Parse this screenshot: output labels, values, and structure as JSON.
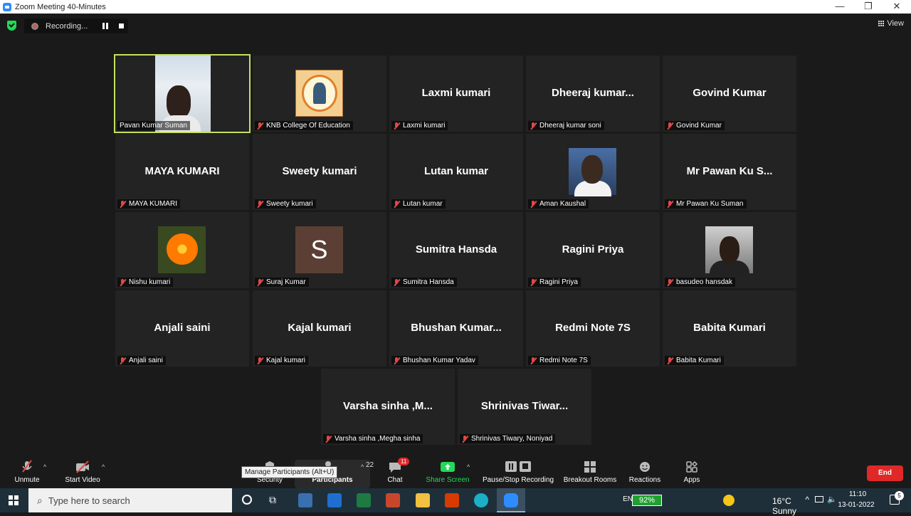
{
  "window": {
    "title": "Zoom Meeting 40-Minutes",
    "minimize": "—",
    "maximize": "❐",
    "close": "✕"
  },
  "recording": {
    "label": "Recording..."
  },
  "view": {
    "label": "View"
  },
  "participants": [
    {
      "display": "",
      "label": "Pavan Kumar Suman",
      "type": "video",
      "active": true
    },
    {
      "display": "",
      "label": "KNB College Of Education",
      "type": "college"
    },
    {
      "display": "Laxmi kumari",
      "label": "Laxmi kumari",
      "type": "name"
    },
    {
      "display": "Dheeraj  kumar...",
      "label": "Dheeraj kumar soni",
      "type": "name"
    },
    {
      "display": "Govind Kumar",
      "label": "Govind Kumar",
      "type": "name"
    },
    {
      "display": "MAYA KUMARI",
      "label": "MAYA KUMARI",
      "type": "name"
    },
    {
      "display": "Sweety kumari",
      "label": "Sweety kumari",
      "type": "name"
    },
    {
      "display": "Lutan kumar",
      "label": "Lutan kumar",
      "type": "name"
    },
    {
      "display": "",
      "label": "Aman Kaushal",
      "type": "aman"
    },
    {
      "display": "Mr  Pawan Ku S...",
      "label": "Mr  Pawan Ku Suman",
      "type": "name"
    },
    {
      "display": "",
      "label": "Nishu kumari",
      "type": "flower"
    },
    {
      "display": "S",
      "label": "Suraj Kumar",
      "type": "initial"
    },
    {
      "display": "Sumitra Hansda",
      "label": "Sumitra Hansda",
      "type": "name"
    },
    {
      "display": "Ragini  Priya",
      "label": "Ragini  Priya",
      "type": "name"
    },
    {
      "display": "",
      "label": "basudeo hansdak",
      "type": "basu"
    },
    {
      "display": "Anjali saini",
      "label": "Anjali saini",
      "type": "name"
    },
    {
      "display": "Kajal kumari",
      "label": "Kajal kumari",
      "type": "name"
    },
    {
      "display": "Bhushan  Kumar...",
      "label": "Bhushan Kumar Yadav",
      "type": "name"
    },
    {
      "display": "Redmi Note 7S",
      "label": "Redmi Note 7S",
      "type": "name"
    },
    {
      "display": "Babita Kumari",
      "label": "Babita Kumari",
      "type": "name"
    },
    {
      "display": "Varsha sinha ,M...",
      "label": "Varsha sinha ,Megha sinha",
      "type": "name"
    },
    {
      "display": "Shrinivas  Tiwar...",
      "label": "Shrinivas Tiwary, Noniyad",
      "type": "name"
    }
  ],
  "toolbar": {
    "unmute": "Unmute",
    "start_video": "Start Video",
    "security": "Security",
    "participants": "Participants",
    "participants_count": "22",
    "chat": "Chat",
    "chat_badge": "11",
    "share_screen": "Share Screen",
    "recording": "Pause/Stop Recording",
    "breakout": "Breakout Rooms",
    "reactions": "Reactions",
    "apps": "Apps",
    "end": "End",
    "tooltip": "Manage Participants (Alt+U)"
  },
  "taskbar": {
    "search_placeholder": "Type here to search",
    "lang": "EN",
    "battery": "92%",
    "weather": "16°C  Sunny",
    "time": "11:10",
    "date": "13-01-2022"
  },
  "colors": {
    "active_border": "#c4e05f",
    "end_red": "#e02828",
    "share_green": "#23d959"
  }
}
